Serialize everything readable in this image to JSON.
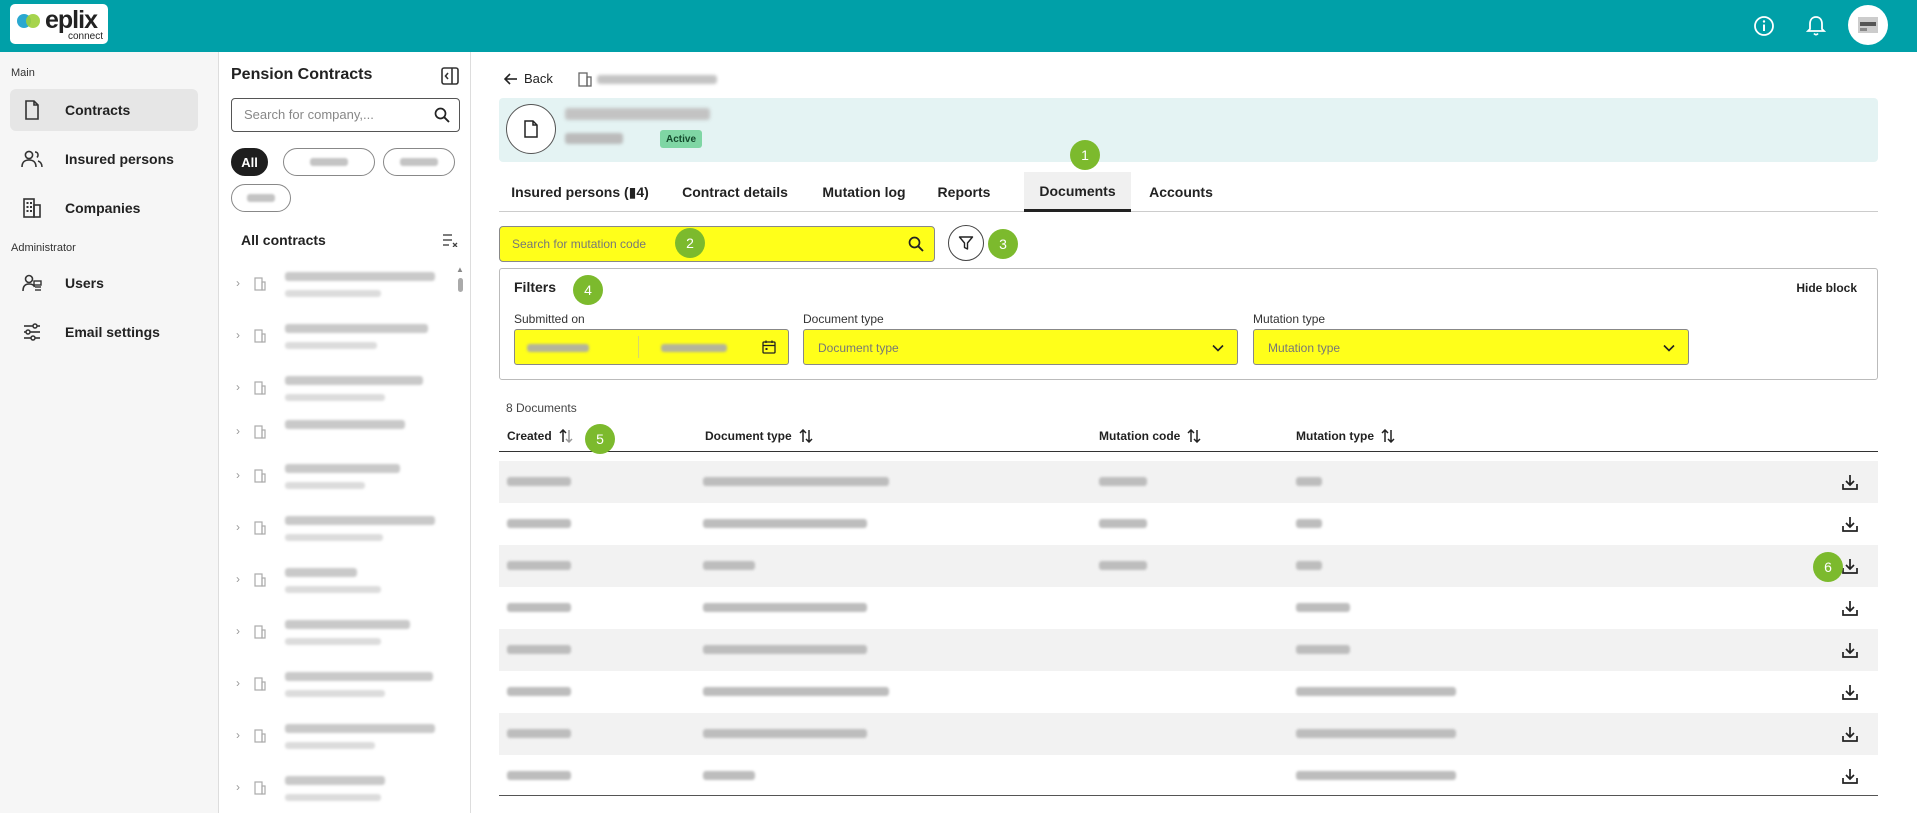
{
  "app": {
    "brand": "eplix",
    "brand_sub": "connect"
  },
  "topbar": {
    "icons": [
      "info-icon",
      "bell-icon",
      "avatar"
    ]
  },
  "left_nav": {
    "section_main": "Main",
    "items_main": [
      {
        "label": "Contracts",
        "icon": "document-icon",
        "active": true
      },
      {
        "label": "Insured persons",
        "icon": "people-icon",
        "active": false
      },
      {
        "label": "Companies",
        "icon": "building-icon",
        "active": false
      }
    ],
    "section_admin": "Administrator",
    "items_admin": [
      {
        "label": "Users",
        "icon": "users-icon"
      },
      {
        "label": "Email settings",
        "icon": "sliders-icon"
      }
    ]
  },
  "contracts_panel": {
    "title": "Pension Contracts",
    "search_placeholder": "Search for company,...",
    "chip_all": "All",
    "list_title": "All contracts"
  },
  "main": {
    "back_label": "Back",
    "status_badge": "Active",
    "tabs": [
      {
        "label": "Insured persons (▮4)",
        "active": false
      },
      {
        "label": "Contract details",
        "active": false
      },
      {
        "label": "Mutation log",
        "active": false
      },
      {
        "label": "Reports",
        "active": false
      },
      {
        "label": "Documents",
        "active": true
      },
      {
        "label": "Accounts",
        "active": false
      }
    ],
    "search_placeholder": "Search for mutation code",
    "filters": {
      "title": "Filters",
      "hide_label": "Hide block",
      "submitted_on_label": "Submitted on",
      "document_type_label": "Document type",
      "document_type_placeholder": "Document type",
      "mutation_type_label": "Mutation type",
      "mutation_type_placeholder": "Mutation type"
    },
    "doc_count": "8 Documents",
    "columns": [
      "Created",
      "Document type",
      "Mutation code",
      "Mutation type"
    ],
    "markers": [
      "1",
      "2",
      "3",
      "4",
      "5",
      "6"
    ]
  },
  "colors": {
    "topbar": "#00a0a8",
    "highlight": "#ffff1a",
    "marker": "#7cba2d",
    "badge_active": "#7fd6a4"
  }
}
